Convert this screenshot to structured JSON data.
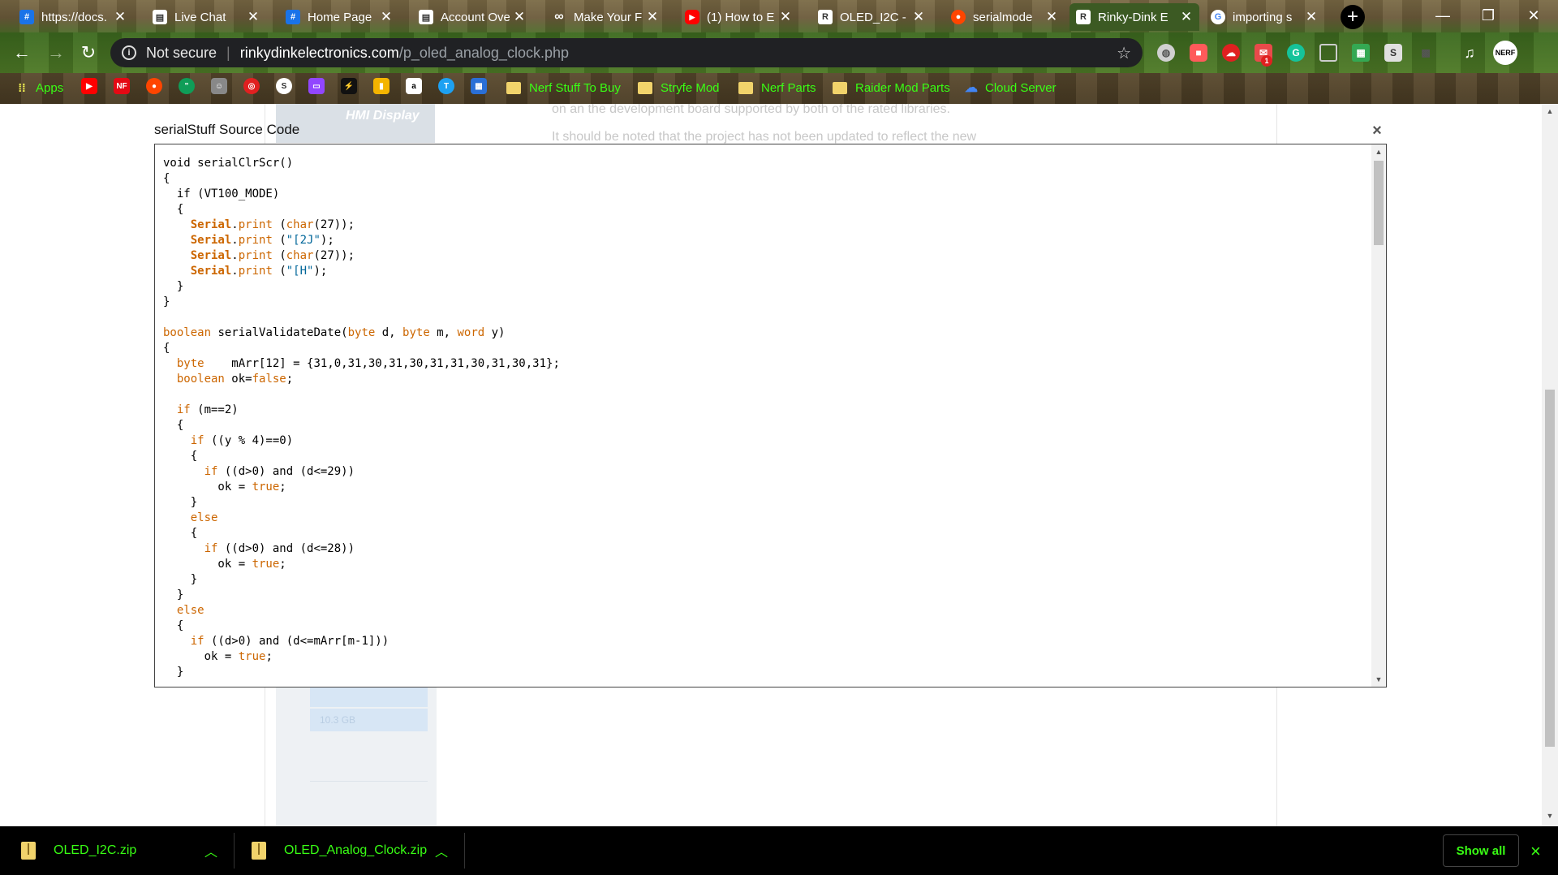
{
  "browser": {
    "tabs": [
      {
        "title": "https://docs.",
        "icon": "hash-icon",
        "color": "#1a73e8"
      },
      {
        "title": "Live Chat",
        "icon": "document-icon",
        "color": "#ffffff"
      },
      {
        "title": "Home Page",
        "icon": "hash-icon",
        "color": "#1a73e8"
      },
      {
        "title": "Account Ove",
        "icon": "document-icon",
        "color": "#ffffff"
      },
      {
        "title": "Make Your F",
        "icon": "infinity-icon",
        "color": "#ffffff"
      },
      {
        "title": "(1) How to E",
        "icon": "youtube-icon",
        "color": "#ff0000"
      },
      {
        "title": "OLED_I2C -",
        "icon": "site-logo-icon",
        "color": "#ffffff"
      },
      {
        "title": "serialmode",
        "icon": "reddit-icon",
        "color": "#ff4500"
      },
      {
        "title": "Rinky-Dink E",
        "icon": "site-logo-icon",
        "color": "#ffffff",
        "active": true
      },
      {
        "title": "importing s",
        "icon": "google-icon",
        "color": "#4285f4"
      }
    ],
    "address": {
      "security": "Not secure",
      "host": "rinkydinkelectronics.com",
      "path": "/p_oled_analog_clock.php"
    },
    "bookmarks": {
      "apps": "Apps",
      "folders": [
        "Nerf Stuff To Buy",
        "Stryfe Mod",
        "Nerf Parts",
        "Raider Mod Parts"
      ],
      "cloud": "Cloud Server"
    },
    "extension_badge": "1",
    "ext_letters": {
      "g": "G",
      "s": "S"
    },
    "bm_letters": {
      "nf": "NF",
      "a": "a",
      "s": "S"
    }
  },
  "background_page": {
    "thumb_label": "HMI Display",
    "text_line_1": "on an the development board supported by both of the rated libraries.",
    "text_line_2": "It should be noted that the project has not been updated to reflect the new",
    "storage_label": "10.3 GB"
  },
  "dialog": {
    "title": "serialStuff Source Code",
    "close": "×",
    "code_lines": [
      [
        [
          "",
          "void serialClrScr()"
        ]
      ],
      [
        [
          "",
          "{"
        ]
      ],
      [
        [
          "",
          "  if (VT100_MODE)"
        ]
      ],
      [
        [
          "",
          "  {"
        ]
      ],
      [
        [
          "",
          "    "
        ],
        [
          "cls",
          "Serial"
        ],
        [
          "",
          "."
        ],
        [
          "kw",
          "print"
        ],
        [
          "",
          " ("
        ],
        [
          "kw",
          "char"
        ],
        [
          "",
          "(27));"
        ]
      ],
      [
        [
          "",
          "    "
        ],
        [
          "cls",
          "Serial"
        ],
        [
          "",
          "."
        ],
        [
          "kw",
          "print"
        ],
        [
          "",
          " ("
        ],
        [
          "str",
          "\"[2J\""
        ],
        [
          "",
          ");"
        ]
      ],
      [
        [
          "",
          "    "
        ],
        [
          "cls",
          "Serial"
        ],
        [
          "",
          "."
        ],
        [
          "kw",
          "print"
        ],
        [
          "",
          " ("
        ],
        [
          "kw",
          "char"
        ],
        [
          "",
          "(27));"
        ]
      ],
      [
        [
          "",
          "    "
        ],
        [
          "cls",
          "Serial"
        ],
        [
          "",
          "."
        ],
        [
          "kw",
          "print"
        ],
        [
          "",
          " ("
        ],
        [
          "str",
          "\"[H\""
        ],
        [
          "",
          ");"
        ]
      ],
      [
        [
          "",
          "  }"
        ]
      ],
      [
        [
          "",
          "}"
        ]
      ],
      [
        [
          "",
          ""
        ]
      ],
      [
        [
          "kw",
          "boolean"
        ],
        [
          "",
          " serialValidateDate("
        ],
        [
          "kw",
          "byte"
        ],
        [
          "",
          " d, "
        ],
        [
          "kw",
          "byte"
        ],
        [
          "",
          " m, "
        ],
        [
          "kw",
          "word"
        ],
        [
          "",
          " y)"
        ]
      ],
      [
        [
          "",
          "{"
        ]
      ],
      [
        [
          "",
          "  "
        ],
        [
          "kw",
          "byte"
        ],
        [
          "",
          "    mArr[12] = {31,0,31,30,31,30,31,31,30,31,30,31};"
        ]
      ],
      [
        [
          "",
          "  "
        ],
        [
          "kw",
          "boolean"
        ],
        [
          "",
          " ok="
        ],
        [
          "kw",
          "false"
        ],
        [
          "",
          ";"
        ]
      ],
      [
        [
          "",
          ""
        ]
      ],
      [
        [
          "",
          "  "
        ],
        [
          "kw",
          "if"
        ],
        [
          "",
          " (m==2)"
        ]
      ],
      [
        [
          "",
          "  {"
        ]
      ],
      [
        [
          "",
          "    "
        ],
        [
          "kw",
          "if"
        ],
        [
          "",
          " ((y % 4)==0)"
        ]
      ],
      [
        [
          "",
          "    {"
        ]
      ],
      [
        [
          "",
          "      "
        ],
        [
          "kw",
          "if"
        ],
        [
          "",
          " ((d>0) and (d<=29))"
        ]
      ],
      [
        [
          "",
          "        ok = "
        ],
        [
          "kw",
          "true"
        ],
        [
          "",
          ";"
        ]
      ],
      [
        [
          "",
          "    }"
        ]
      ],
      [
        [
          "",
          "    "
        ],
        [
          "kw",
          "else"
        ]
      ],
      [
        [
          "",
          "    {"
        ]
      ],
      [
        [
          "",
          "      "
        ],
        [
          "kw",
          "if"
        ],
        [
          "",
          " ((d>0) and (d<=28))"
        ]
      ],
      [
        [
          "",
          "        ok = "
        ],
        [
          "kw",
          "true"
        ],
        [
          "",
          ";"
        ]
      ],
      [
        [
          "",
          "    }"
        ]
      ],
      [
        [
          "",
          "  }"
        ]
      ],
      [
        [
          "",
          "  "
        ],
        [
          "kw",
          "else"
        ]
      ],
      [
        [
          "",
          "  {"
        ]
      ],
      [
        [
          "",
          "    "
        ],
        [
          "kw",
          "if"
        ],
        [
          "",
          " ((d>0) and (d<=mArr[m-1]))"
        ]
      ],
      [
        [
          "",
          "      ok = "
        ],
        [
          "kw",
          "true"
        ],
        [
          "",
          ";"
        ]
      ],
      [
        [
          "",
          "  }"
        ]
      ]
    ]
  },
  "downloads": {
    "items": [
      "OLED_I2C.zip",
      "OLED_Analog_Clock.zip"
    ],
    "show_all": "Show all",
    "close": "×"
  },
  "colors": {
    "accent_green": "#39ff14",
    "keyword": "#cc6600",
    "string": "#006699"
  }
}
